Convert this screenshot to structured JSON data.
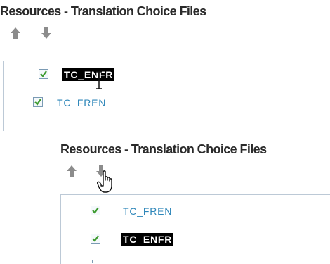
{
  "before": {
    "title": "Resources - Translation Choice Files",
    "up_icon": "arrow-up-icon",
    "down_icon": "arrow-down-icon",
    "items": [
      {
        "label": "TC_ENFR",
        "checked": true,
        "selected": true
      },
      {
        "label": "TC_FREN",
        "checked": true,
        "selected": false
      }
    ],
    "cursor": "text-ibeam-cursor"
  },
  "after": {
    "title": "Resources - Translation Choice Files",
    "up_icon": "arrow-up-icon",
    "down_icon": "arrow-down-icon",
    "items": [
      {
        "label": "TC_FREN",
        "checked": true,
        "selected": false
      },
      {
        "label": "TC_ENFR",
        "checked": true,
        "selected": true
      }
    ],
    "cursor": "hand-pointer-cursor"
  },
  "colors": {
    "title": "#2a2a2a",
    "item_text": "#2d86b9",
    "selected_bg": "#000000",
    "selected_text": "#ffffff",
    "checkmark": "#3c9a2e",
    "arrow": "#8c8c8c",
    "tree_border": "#bcc9d6"
  }
}
